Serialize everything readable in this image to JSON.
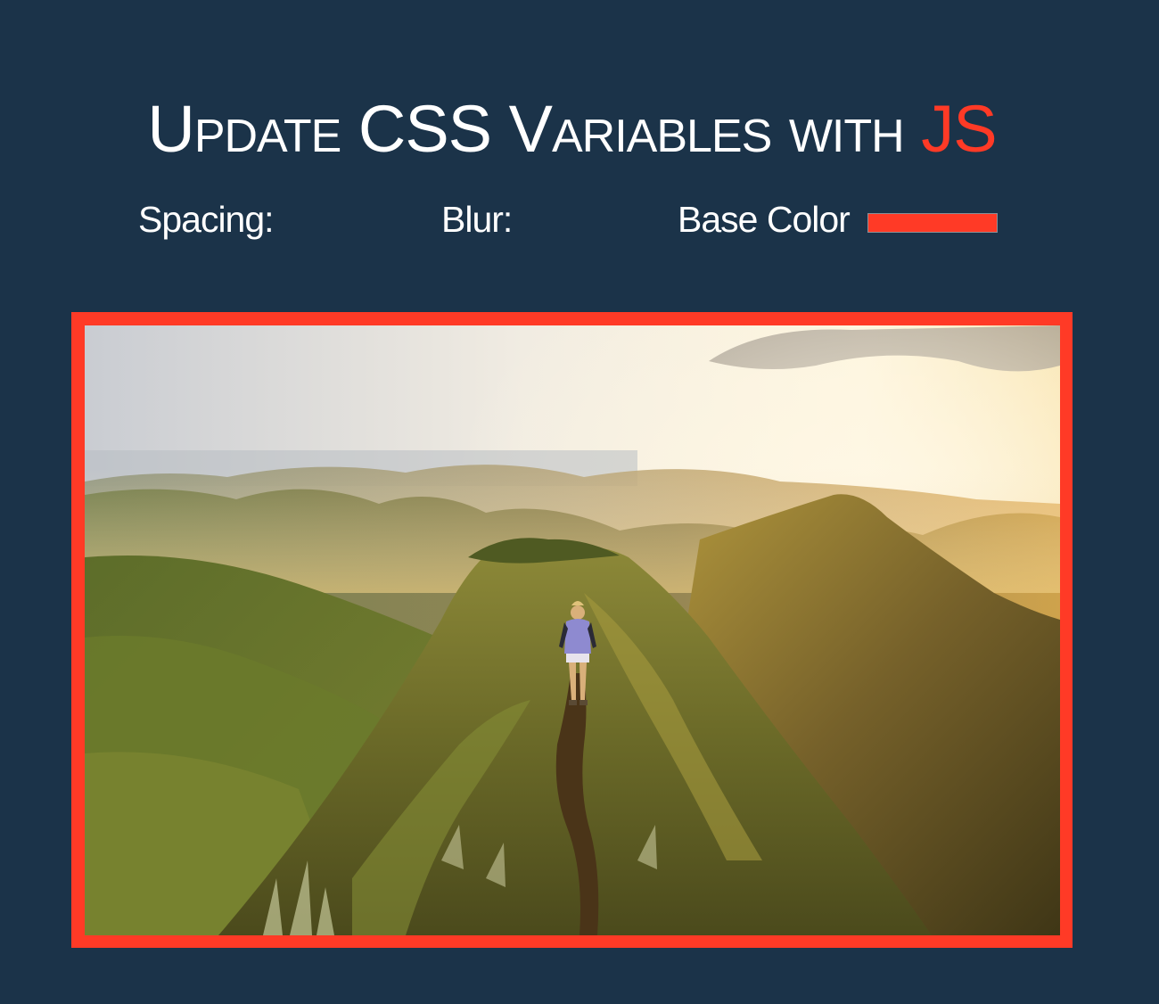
{
  "header": {
    "title_main": "Update CSS Variables with ",
    "title_highlight": "JS",
    "highlight_color": "#ff3a26"
  },
  "controls": {
    "spacing_label": "Spacing:",
    "blur_label": "Blur:",
    "base_color_label": "Base Color",
    "base_color_value": "#ff3a26"
  },
  "photo": {
    "subject": "hiker walking along a grassy mountain ridge trail at sunset",
    "frame_color": "#ff3a26"
  },
  "colors": {
    "background": "#1b3349",
    "text": "#ffffff",
    "accent": "#ff3a26"
  }
}
